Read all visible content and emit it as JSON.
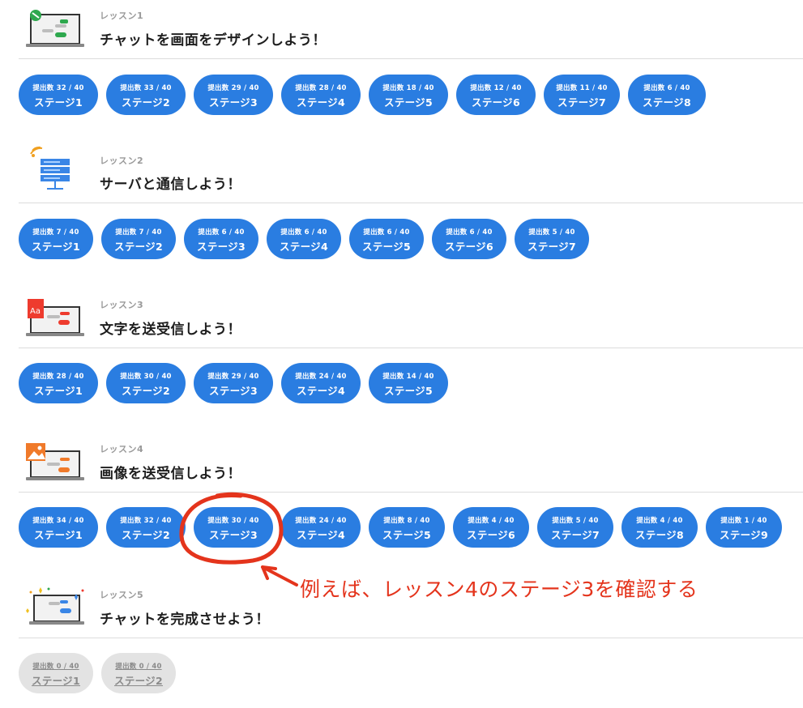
{
  "lessons": [
    {
      "number": "レッスン1",
      "title": "チャットを画面をデザインしよう！",
      "icon": "chat-design-icon",
      "stages": [
        {
          "count": "提出数 32 / 40",
          "label": "ステージ1"
        },
        {
          "count": "提出数 33 / 40",
          "label": "ステージ2"
        },
        {
          "count": "提出数 29 / 40",
          "label": "ステージ3"
        },
        {
          "count": "提出数 28 / 40",
          "label": "ステージ4"
        },
        {
          "count": "提出数 18 / 40",
          "label": "ステージ5"
        },
        {
          "count": "提出数 12 / 40",
          "label": "ステージ6"
        },
        {
          "count": "提出数 11 / 40",
          "label": "ステージ7"
        },
        {
          "count": "提出数 6 / 40",
          "label": "ステージ8"
        }
      ]
    },
    {
      "number": "レッスン2",
      "title": "サーバと通信しよう！",
      "icon": "server-icon",
      "stages": [
        {
          "count": "提出数 7 / 40",
          "label": "ステージ1"
        },
        {
          "count": "提出数 7 / 40",
          "label": "ステージ2"
        },
        {
          "count": "提出数 6 / 40",
          "label": "ステージ3"
        },
        {
          "count": "提出数 6 / 40",
          "label": "ステージ4"
        },
        {
          "count": "提出数 6 / 40",
          "label": "ステージ5"
        },
        {
          "count": "提出数 6 / 40",
          "label": "ステージ6"
        },
        {
          "count": "提出数 5 / 40",
          "label": "ステージ7"
        }
      ]
    },
    {
      "number": "レッスン3",
      "title": "文字を送受信しよう！",
      "icon": "text-message-icon",
      "stages": [
        {
          "count": "提出数 28 / 40",
          "label": "ステージ1"
        },
        {
          "count": "提出数 30 / 40",
          "label": "ステージ2"
        },
        {
          "count": "提出数 29 / 40",
          "label": "ステージ3"
        },
        {
          "count": "提出数 24 / 40",
          "label": "ステージ4"
        },
        {
          "count": "提出数 14 / 40",
          "label": "ステージ5"
        }
      ]
    },
    {
      "number": "レッスン4",
      "title": "画像を送受信しよう！",
      "icon": "image-message-icon",
      "stages": [
        {
          "count": "提出数 34 / 40",
          "label": "ステージ1"
        },
        {
          "count": "提出数 32 / 40",
          "label": "ステージ2"
        },
        {
          "count": "提出数 30 / 40",
          "label": "ステージ3"
        },
        {
          "count": "提出数 24 / 40",
          "label": "ステージ4"
        },
        {
          "count": "提出数 8 / 40",
          "label": "ステージ5"
        },
        {
          "count": "提出数 4 / 40",
          "label": "ステージ6"
        },
        {
          "count": "提出数 5 / 40",
          "label": "ステージ7"
        },
        {
          "count": "提出数 4 / 40",
          "label": "ステージ8"
        },
        {
          "count": "提出数 1 / 40",
          "label": "ステージ9"
        }
      ]
    },
    {
      "number": "レッスン5",
      "title": "チャットを完成させよう！",
      "icon": "celebration-icon",
      "stages": [
        {
          "count": "提出数 0 / 40",
          "label": "ステージ1"
        },
        {
          "count": "提出数 0 / 40",
          "label": "ステージ2"
        }
      ]
    }
  ],
  "annotation": {
    "text": "例えば、レッスン4のステージ3を確認する",
    "color": "#e4341c"
  },
  "colors": {
    "stage_active": "#2a7de1",
    "stage_locked": "#e3e3e3"
  }
}
